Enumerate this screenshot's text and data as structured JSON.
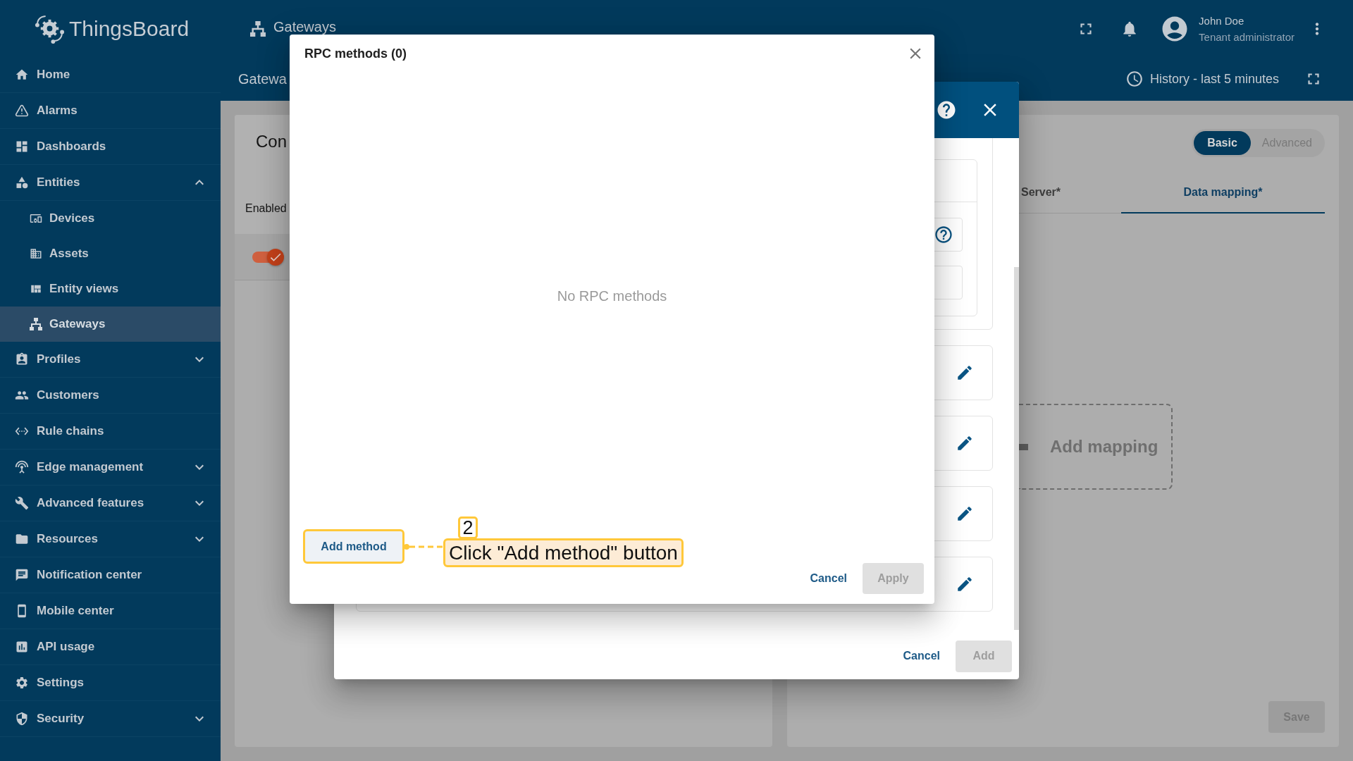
{
  "sidebar": {
    "logo": "ThingsBoard",
    "items": [
      {
        "label": "Home",
        "selected": false
      },
      {
        "label": "Alarms",
        "selected": false
      },
      {
        "label": "Dashboards",
        "selected": false
      },
      {
        "label": "Entities",
        "selected": false,
        "expanded": true,
        "children": [
          {
            "label": "Devices",
            "selected": false
          },
          {
            "label": "Assets",
            "selected": false
          },
          {
            "label": "Entity views",
            "selected": false
          },
          {
            "label": "Gateways",
            "selected": true
          }
        ]
      },
      {
        "label": "Profiles",
        "selected": false,
        "expanded": false
      },
      {
        "label": "Customers",
        "selected": false
      },
      {
        "label": "Rule chains",
        "selected": false
      },
      {
        "label": "Edge management",
        "selected": false,
        "expanded": false
      },
      {
        "label": "Advanced features",
        "selected": false,
        "expanded": false
      },
      {
        "label": "Resources",
        "selected": false,
        "expanded": false
      },
      {
        "label": "Notification center",
        "selected": false
      },
      {
        "label": "Mobile center",
        "selected": false
      },
      {
        "label": "API usage",
        "selected": false
      },
      {
        "label": "Settings",
        "selected": false
      },
      {
        "label": "Security",
        "selected": false,
        "expanded": false
      }
    ]
  },
  "header": {
    "title": "Gateways",
    "user": {
      "name": "John Doe",
      "role": "Tenant administrator"
    }
  },
  "toolbar": {
    "title": "Gatewa",
    "time_window": "History - last 5 minutes"
  },
  "connectors_card": {
    "title": "Con",
    "columns": [
      "Enabled"
    ],
    "rows": [
      {
        "enabled": true
      }
    ]
  },
  "config_card": {
    "modes": [
      {
        "label": "Basic",
        "selected": true
      },
      {
        "label": "Advanced",
        "selected": false
      }
    ],
    "tabs": [
      {
        "label": "Server*",
        "selected": false
      },
      {
        "label": "Data mapping*",
        "selected": true
      }
    ],
    "add_mapping": "Add mapping",
    "save": {
      "label": "Save",
      "disabled": true
    }
  },
  "connector_dialog": {
    "actions": [
      {
        "label": "Cancel",
        "kind": "text",
        "disabled": false
      },
      {
        "label": "Add",
        "kind": "filled",
        "disabled": true
      }
    ]
  },
  "rpc_dialog": {
    "title": "RPC methods (0)",
    "empty_text": "No RPC methods",
    "add_button": {
      "label": "Add method",
      "highlighted": true
    },
    "actions": [
      {
        "label": "Cancel",
        "kind": "text",
        "disabled": false
      },
      {
        "label": "Apply",
        "kind": "filled",
        "disabled": true
      }
    ]
  },
  "annotation": {
    "step": "2",
    "text": "Click \"Add method\" button"
  }
}
